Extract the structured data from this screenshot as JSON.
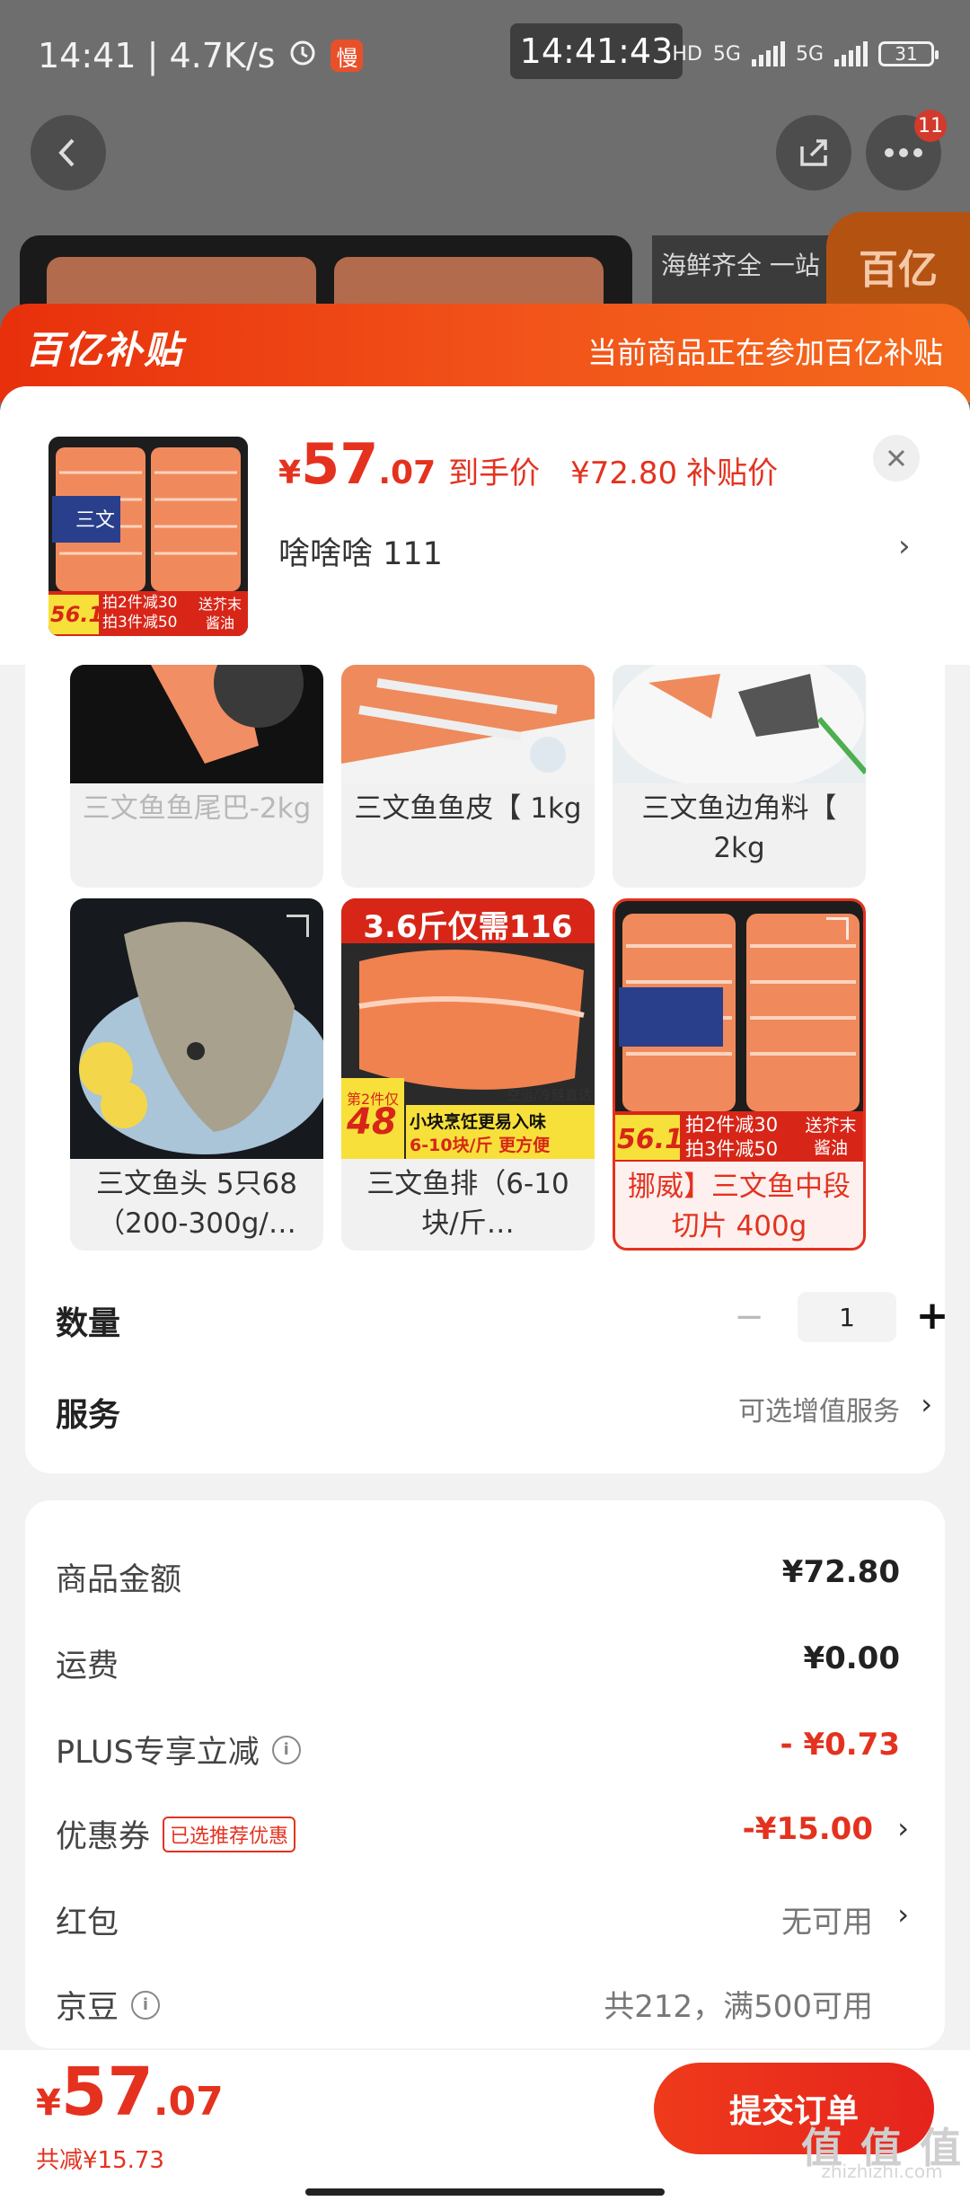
{
  "status_bar": {
    "left_text": "14:41 | 4.7K/s",
    "clock": "14:41:43",
    "network_hd": "HD",
    "network_5g_1": "5G",
    "network_5g_2": "5G",
    "battery": "31"
  },
  "top_nav": {
    "notification_count": "11"
  },
  "background": {
    "banner_text": "海鲜齐全 一站   让餐桌",
    "corner_logo": "百亿"
  },
  "subsidy_header": {
    "logo": "百亿补贴",
    "note": "当前商品正在参加百亿补贴"
  },
  "product": {
    "price_symbol": "¥",
    "price_int": "57",
    "price_dec": ".07",
    "price_label": "到手价",
    "subsidy_price": "¥72.80",
    "subsidy_label": "补贴价",
    "variant": "啥啥啥  111",
    "thumb_badge_price": "56.1",
    "thumb_promo_1": "拍2件减30",
    "thumb_promo_2": "拍3件减50",
    "thumb_gift": "送芥末酱油"
  },
  "specs": [
    {
      "label": "三文鱼鱼尾巴-2kg"
    },
    {
      "label": "三文鱼鱼皮【 1kg"
    },
    {
      "label": "三文鱼边角料【 2kg"
    },
    {
      "label": "三文鱼头 5只68（200-300g/…"
    },
    {
      "label": "三文鱼排（6-10块/斤…",
      "img_banner": "3.6斤仅需116",
      "img_tag_1": "小块烹饪更易入味",
      "img_tag_2": "6-10块/斤 更方便",
      "img_price": "48",
      "img_price_note": "第2件仅",
      "img_ship": "空运/冷链直达"
    },
    {
      "label": "挪威】三文鱼中段 切片 400g",
      "img_price": "56.1",
      "img_promo_1": "拍2件减30",
      "img_promo_2": "拍3件减50",
      "img_gift": "送芥末酱油"
    }
  ],
  "quantity": {
    "label": "数量",
    "minus": "−",
    "value": "1",
    "plus": "+"
  },
  "service": {
    "label": "服务",
    "value": "可选增值服务"
  },
  "fees": {
    "goods": {
      "label": "商品金额",
      "value": "¥72.80"
    },
    "shipping": {
      "label": "运费",
      "value": "¥0.00"
    },
    "plus": {
      "label": "PLUS专享立减",
      "value": "- ¥0.73"
    },
    "coupon": {
      "label": "优惠券",
      "tag": "已选推荐优惠",
      "value": "-¥15.00"
    },
    "redpacket": {
      "label": "红包",
      "value": "无可用"
    },
    "jingdou": {
      "label": "京豆",
      "value": "共212，满500可用"
    }
  },
  "bottom": {
    "symbol": "¥",
    "total_int": "57",
    "total_dec": ".07",
    "saved": "共减¥15.73",
    "submit": "提交订单"
  },
  "watermark": {
    "logo": "值 值 值",
    "url": "zhizhizhi.com"
  },
  "colors": {
    "accent": "#e4321f",
    "header_gradient_start": "#e8300c",
    "header_gradient_end": "#f46a1c"
  }
}
